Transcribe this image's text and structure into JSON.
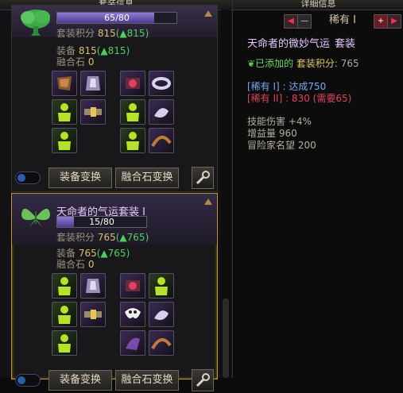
{
  "left_header_title": "套装信息",
  "right_header_title": "详细信息",
  "card1": {
    "progress_text": "65/80",
    "progress_fraction": 0.8125,
    "points_label": "套装积分",
    "points_value": "815",
    "points_delta": "(▲815)",
    "equip_label": "装备",
    "equip_value": "815",
    "equip_delta": "(▲815)",
    "fusion_label": "融合石",
    "fusion_value": "0",
    "equip_change_label": "装备变换",
    "fusion_change_label": "融合石变换"
  },
  "card2": {
    "set_name": "天命者的气运套装 I",
    "progress_text": "15/80",
    "progress_fraction": 0.1875,
    "points_label": "套装积分",
    "points_value": "765",
    "points_delta": "(▲765)",
    "equip_label": "装备",
    "equip_value": "765",
    "equip_delta": "(▲765)",
    "fusion_label": "融合石",
    "fusion_value": "0",
    "equip_change_label": "装备变换",
    "fusion_change_label": "融合石变换"
  },
  "rarity_selector": {
    "label": "稀有 I",
    "prev_fast": "◀",
    "prev": "—",
    "next": "+",
    "next_fast": "▶"
  },
  "detail": {
    "title": "天命者的微妙气运",
    "title_suffix": "套装",
    "added_prefix": "已添加的",
    "added_label": "套装积分",
    "added_value": ": 765",
    "tier1": "[稀有 I] : 达成750",
    "tier2": "[稀有 II] : 830 (需要65)",
    "skill_damage": "技能伤害 +4%",
    "gain": "增益量 960",
    "fame": "冒险家名望 200"
  },
  "colors": {
    "accent_purple": "#c58cf0",
    "gold_border": "#b8962f",
    "green_up": "#4fd05e",
    "red_tier": "#e0445a"
  }
}
